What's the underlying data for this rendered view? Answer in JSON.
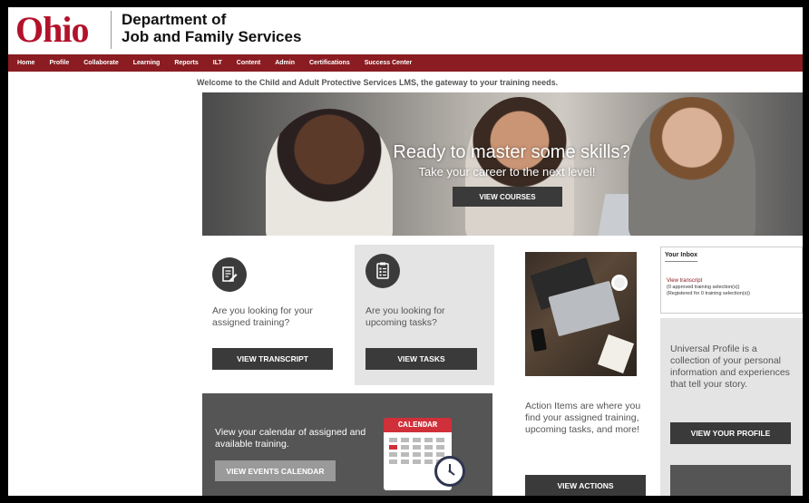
{
  "header": {
    "logo_o": "O",
    "logo_rest": "hio",
    "dept_line1": "Department of",
    "dept_line2": "Job and Family Services"
  },
  "nav": {
    "items": [
      "Home",
      "Profile",
      "Collaborate",
      "Learning",
      "Reports",
      "ILT",
      "Content",
      "Admin",
      "Certifications",
      "Success Center"
    ]
  },
  "welcome": "Welcome to the Child and Adult Protective Services LMS, the gateway to your training needs.",
  "hero": {
    "title": "Ready to master some skills?",
    "subtitle": "Take your career to the next level!",
    "button": "VIEW COURSES"
  },
  "cards": {
    "transcript": {
      "text": "Are you looking for your assigned training?",
      "button": "VIEW TRANSCRIPT",
      "icon": "edit-document-icon"
    },
    "tasks": {
      "text": "Are you looking for upcoming tasks?",
      "button": "VIEW TASKS",
      "icon": "checklist-icon"
    },
    "actions": {
      "text": "Action Items are where you find your assigned training, upcoming tasks, and more!",
      "button": "VIEW ACTIONS"
    },
    "calendar": {
      "text": "View your calendar of assigned and available training.",
      "button": "VIEW EVENTS CALENDAR",
      "icon_label": "CALENDAR"
    },
    "profile": {
      "text": "Universal Profile is a collection of your personal information and experiences that tell your story.",
      "button": "VIEW YOUR PROFILE"
    }
  },
  "inbox": {
    "title": "Your Inbox",
    "link": "View transcript",
    "line1": "(0 approved training selection(s))",
    "line2": "(Registered for 0 training selection(s))"
  },
  "colors": {
    "brand_red": "#b3122b",
    "nav_bar": "#8a1c22",
    "button_dark": "#3a3a3a"
  }
}
